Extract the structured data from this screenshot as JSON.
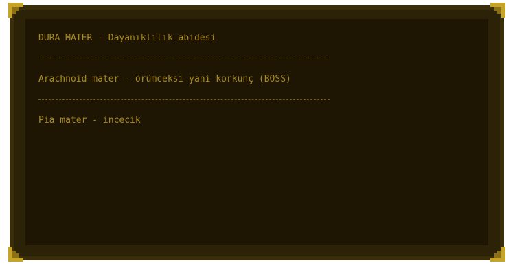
{
  "dialog": {
    "line1": "DURA MATER - Dayanıklılık abidesi",
    "line2": "Arachnoid mater - örümceksi yani korkunç (BOSS)",
    "line3": "Pia mater - incecik"
  },
  "colors": {
    "text": "#a88b1d",
    "panel": "#1e1503",
    "frame": "#3a2e0a",
    "corner": "#c6a42a"
  }
}
